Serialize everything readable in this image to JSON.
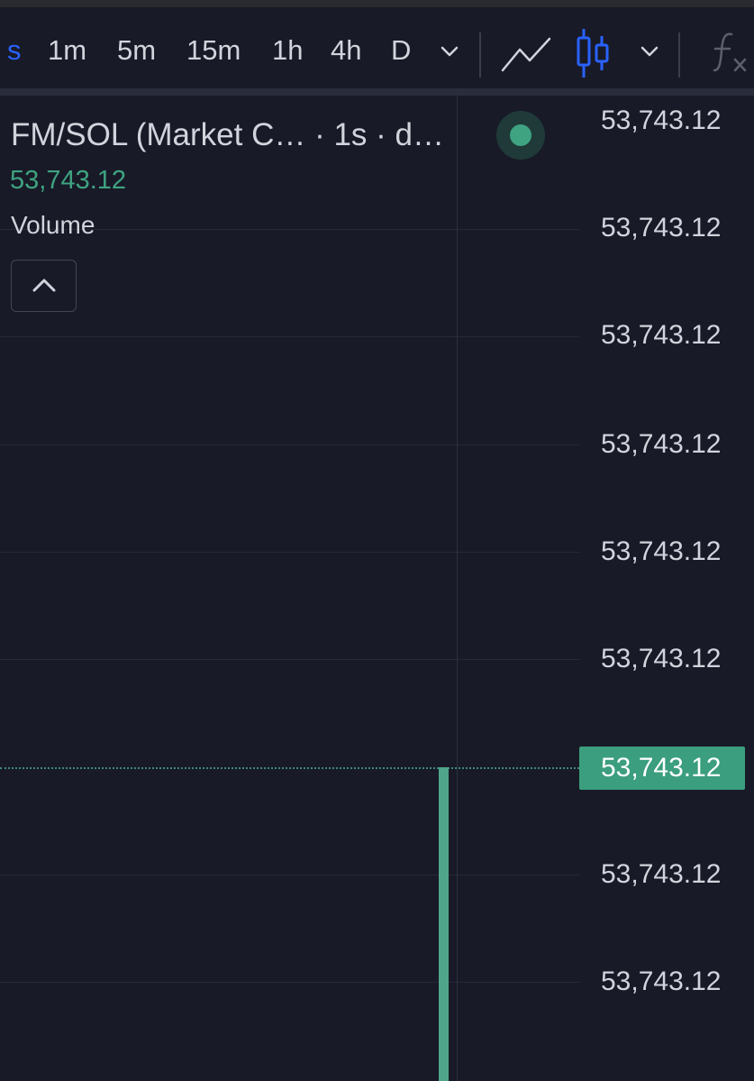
{
  "toolbar": {
    "timeframes": [
      "s",
      "1m",
      "5m",
      "15m",
      "1h",
      "4h",
      "D"
    ],
    "active_timeframe": "s"
  },
  "legend": {
    "title": "FM/SOL (Market C…  · 1s · d…",
    "price": "53,743.12",
    "indicator": "Volume"
  },
  "price_axis": {
    "labels": [
      "53,743.12",
      "53,743.12",
      "53,743.12",
      "53,743.12",
      "53,743.12",
      "53,743.12",
      "53,743.12",
      "53,743.12"
    ],
    "current_price": "53,743.12"
  },
  "colors": {
    "background": "#181a27",
    "accent": "#2962ff",
    "up": "#4fa589",
    "text": "#d1d4dc"
  },
  "icons": {
    "timeframe_dropdown": "chevron-down-icon",
    "line_chart": "line-chart-icon",
    "candle_chart": "candlestick-icon",
    "chart_type_dropdown": "chevron-down-icon",
    "indicators": "fx-icon",
    "collapse": "chevron-up-icon"
  }
}
